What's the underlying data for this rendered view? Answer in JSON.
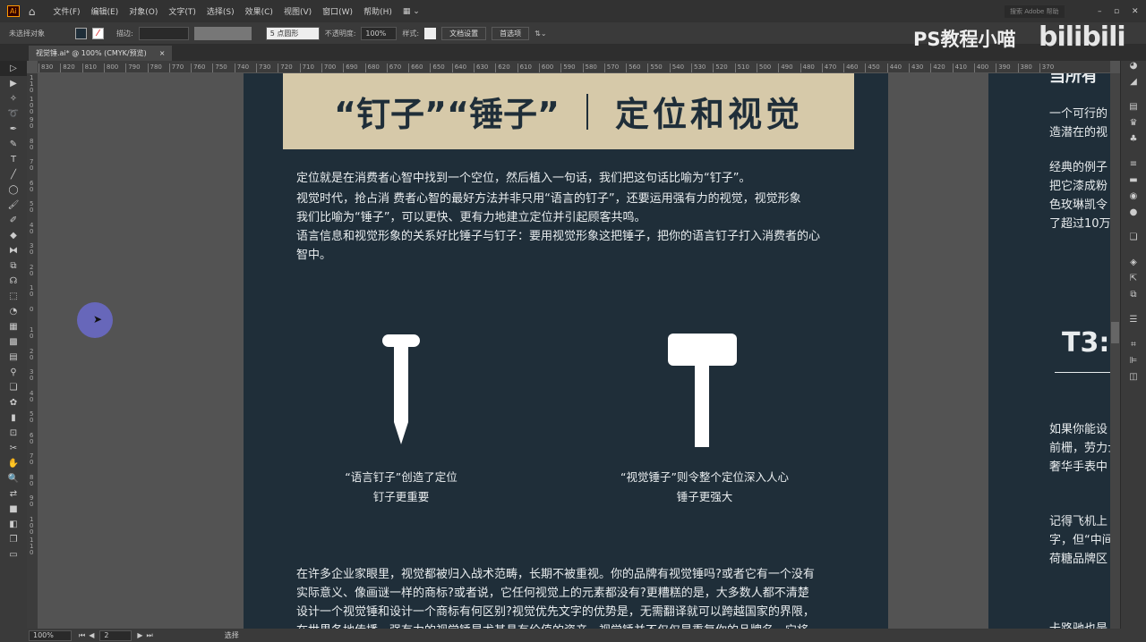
{
  "app": {
    "logo": "Ai",
    "menus": [
      "文件(F)",
      "编辑(E)",
      "对象(O)",
      "文字(T)",
      "选择(S)",
      "效果(C)",
      "视图(V)",
      "窗口(W)",
      "帮助(H)"
    ],
    "search_placeholder": "搜索 Adobe 帮助"
  },
  "control": {
    "selection": "未选择对象",
    "stroke_label": "描边:",
    "brush": "5 点圆形",
    "opacity_label": "不透明度:",
    "opacity": "100%",
    "style_label": "样式:",
    "doc_setup": "文档设置",
    "prefs": "首选项"
  },
  "tab": {
    "title": "视觉锤.ai* @ 100% (CMYK/预览)",
    "close": "×"
  },
  "ruler_h": [
    "830",
    "820",
    "810",
    "800",
    "790",
    "780",
    "770",
    "760",
    "750",
    "740",
    "730",
    "720",
    "710",
    "700",
    "690",
    "680",
    "670",
    "660",
    "650",
    "640",
    "630",
    "620",
    "610",
    "600",
    "590",
    "580",
    "570",
    "560",
    "550",
    "540",
    "530",
    "520",
    "510",
    "500",
    "490",
    "480",
    "470",
    "460",
    "450",
    "440",
    "430",
    "420",
    "410",
    "400",
    "390",
    "380",
    "370"
  ],
  "ruler_v": [
    "110",
    "100",
    "90",
    "80",
    "70",
    "60",
    "50",
    "40",
    "30",
    "20",
    "10",
    "0",
    "10",
    "20",
    "30",
    "40",
    "50",
    "60",
    "70",
    "80",
    "90",
    "100",
    "110"
  ],
  "artboard": {
    "title_left": "“钉子”“锤子”",
    "title_right": "定位和视觉",
    "intro": [
      "定位就是在消费者心智中找到一个空位，然后植入一句话，我们把这句话比喻为“钉子”。",
      "视觉时代，抢占消 费者心智的最好方法并非只用“语言的钉子”，还要运用强有力的视觉，视觉形象",
      "我们比喻为“锤子”，可以更快、更有力地建立定位并引起顾客共鸣。",
      "语言信息和视觉形象的关系好比锤子与钉子：要用视觉形象这把锤子，把你的语言钉子打入消费者的心",
      "智中。"
    ],
    "nail_caption": [
      "“语言钉子”创造了定位",
      "钉子更重要"
    ],
    "hammer_caption": [
      "“视觉锤子”则令整个定位深入人心",
      "锤子更强大"
    ],
    "body": [
      "在许多企业家眼里，视觉都被归入战术范畴，长期不被重视。你的品牌有视觉锤吗?或者它有一个没有",
      "实际意义、像画谜一样的商标?或者说，它任何视觉上的元素都没有?更糟糕的是，大多数人都不清楚",
      "设计一个视觉锤和设计一个商标有何区别?视觉优先文字的优势是，无需翻译就可以跨越国家的界限，",
      "在世界各地传播。强有力的视觉锤是尤其具有价值的资产。视觉锤并不仅仅是重复你的品牌名，它将一"
    ]
  },
  "artboard2": {
    "heading": "当所有",
    "p1": [
      "一个可行的",
      "造潜在的视"
    ],
    "p2": [
      "经典的例子",
      "把它漆成粉",
      "色玫琳凯令",
      "了超过10万"
    ],
    "t3": "T3:",
    "p3": [
      "如果你能设",
      "前栅，劳力士",
      "奢华手表中"
    ],
    "p4": [
      "记得飞机上",
      "字，但“中间",
      "荷糖品牌区"
    ],
    "p5": "卡路驰也是"
  },
  "status": {
    "zoom": "100%",
    "page": "2",
    "tool": "选择"
  },
  "watermark": {
    "text": "PS教程小喵",
    "logo": "bilibili"
  },
  "colors": {
    "artboard": "#1f2e39",
    "banner": "#d6c9a9"
  }
}
